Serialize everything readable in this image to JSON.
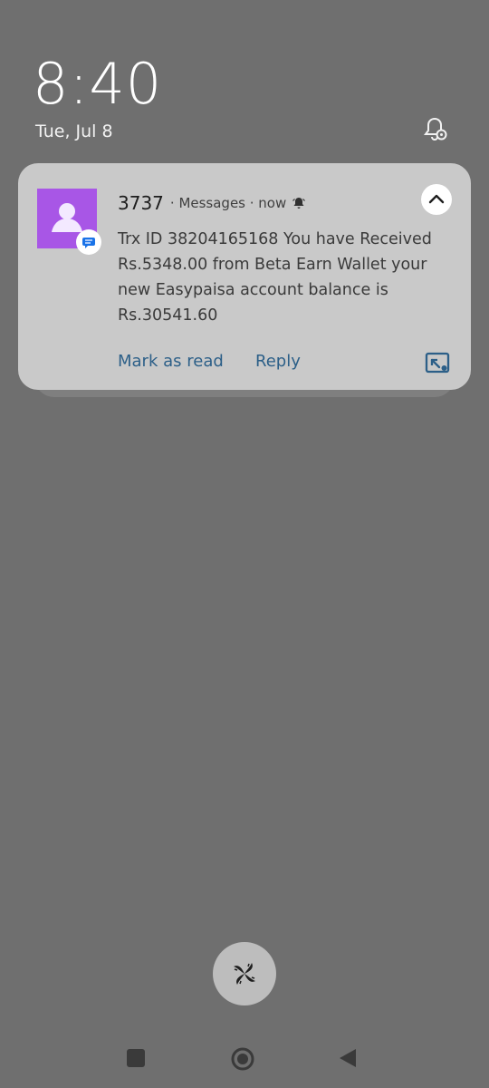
{
  "lockscreen": {
    "time": "8:40",
    "date": "Tue, Jul 8",
    "status_icon": "notification-settings-icon"
  },
  "notification": {
    "sender": "3737",
    "app_name": "· Messages · now",
    "alarm_icon": "alarm-bell-icon",
    "avatar_color": "#a856e6",
    "badge_icon": "messages-app-icon",
    "collapse_icon": "chevron-up-icon",
    "message": "Trx ID 38204165168 You have Received Rs.5348.00 from Beta Earn Wallet your new Easypaisa account balance is Rs.30541.60",
    "actions": [
      {
        "label": "Mark as read"
      },
      {
        "label": "Reply"
      }
    ],
    "expand_icon": "screenshot-share-icon"
  },
  "unlock": {
    "icon": "fingerprint-swirl-icon"
  },
  "nav": {
    "recents_icon": "square-icon",
    "home_icon": "circle-icon",
    "back_icon": "triangle-left-icon"
  },
  "colors": {
    "background": "#6f6f6f",
    "card": "#c9c9c9",
    "accent": "#2c5f88",
    "avatar": "#a856e6"
  }
}
